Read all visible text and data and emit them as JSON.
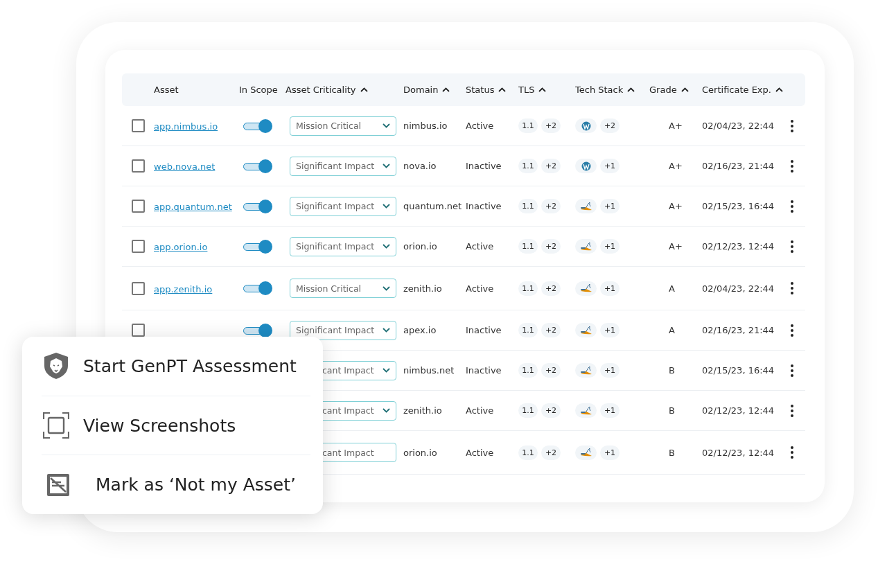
{
  "table": {
    "columns": [
      {
        "label": "Asset",
        "sortable": false
      },
      {
        "label": "In Scope",
        "sortable": false
      },
      {
        "label": "Asset Criticality",
        "sortable": true
      },
      {
        "label": "Domain",
        "sortable": true
      },
      {
        "label": "Status",
        "sortable": true
      },
      {
        "label": "TLS",
        "sortable": true
      },
      {
        "label": "Tech Stack",
        "sortable": true
      },
      {
        "label": "Grade",
        "sortable": true
      },
      {
        "label": "Certificate Exp.",
        "sortable": true
      }
    ],
    "rows": [
      {
        "checked": false,
        "asset": "app.nimbus.io",
        "in_scope": true,
        "criticality": "Mission Critical",
        "has_caret": true,
        "domain": "nimbus.io",
        "status": "Active",
        "tls": [
          "1.1",
          "+2"
        ],
        "tech": {
          "kind": "wordpress",
          "more": "+2"
        },
        "grade": "A+",
        "cert": "02/04/23, 22:44"
      },
      {
        "checked": false,
        "asset": "web.nova.net",
        "in_scope": true,
        "criticality": "Significant Impact",
        "has_caret": true,
        "domain": "nova.io",
        "status": "Inactive",
        "tls": [
          "1.1",
          "+2"
        ],
        "tech": {
          "kind": "wordpress",
          "more": "+1"
        },
        "grade": "A+",
        "cert": "02/16/23, 21:44"
      },
      {
        "checked": false,
        "asset": "app.quantum.net",
        "in_scope": true,
        "criticality": "Significant Impact",
        "has_caret": true,
        "domain": "quantum.net",
        "status": "Inactive",
        "tls": [
          "1.1",
          "+2"
        ],
        "tech": {
          "kind": "mysql",
          "more": "+1"
        },
        "grade": "A+",
        "cert": "02/15/23, 16:44"
      },
      {
        "checked": false,
        "asset": "app.orion.io",
        "in_scope": true,
        "criticality": "Significant Impact",
        "has_caret": true,
        "domain": "orion.io",
        "status": "Active",
        "tls": [
          "1.1",
          "+2"
        ],
        "tech": {
          "kind": "mysql",
          "more": "+1"
        },
        "grade": "A+",
        "cert": "02/12/23, 12:44"
      },
      {
        "checked": false,
        "asset": "app.zenith.io",
        "in_scope": true,
        "criticality": "Mission Critical",
        "has_caret": true,
        "domain": "zenith.io",
        "status": "Active",
        "tls": [
          "1.1",
          "+2"
        ],
        "tech": {
          "kind": "mysql",
          "more": "+1"
        },
        "grade": "A",
        "cert": "02/04/23, 22:44"
      },
      {
        "checked": false,
        "in_scope": true,
        "criticality": "Significant Impact",
        "has_caret": true,
        "domain": "apex.io",
        "status": "Inactive",
        "tls": [
          "1.1",
          "+2"
        ],
        "tech": {
          "kind": "mysql",
          "more": "+1"
        },
        "grade": "A",
        "cert": "02/16/23, 21:44"
      },
      {
        "criticality": "cant Impact",
        "has_caret": true,
        "domain": "nimbus.net",
        "status": "Inactive",
        "tls": [
          "1.1",
          "+2"
        ],
        "tech": {
          "kind": "mysql",
          "more": "+1"
        },
        "grade": "B",
        "cert": "02/15/23, 16:44"
      },
      {
        "criticality": "cant Impact",
        "has_caret": true,
        "domain": "zenith.io",
        "status": "Active",
        "tls": [
          "1.1",
          "+2"
        ],
        "tech": {
          "kind": "mysql",
          "more": "+1"
        },
        "grade": "B",
        "cert": "02/12/23, 12:44"
      },
      {
        "criticality": "cant Impact",
        "has_caret": false,
        "domain": "orion.io",
        "status": "Active",
        "tls": [
          "1.1",
          "+2"
        ],
        "tech": {
          "kind": "mysql",
          "more": "+1"
        },
        "grade": "B",
        "cert": "02/12/23, 12:44"
      }
    ]
  },
  "context_menu": {
    "items": [
      {
        "kind": "assessment",
        "label": "Start GenPT Assessment"
      },
      {
        "kind": "screenshots",
        "label": "View Screenshots"
      },
      {
        "kind": "exclude",
        "label": "Mark as ‘Not my Asset’"
      }
    ]
  }
}
